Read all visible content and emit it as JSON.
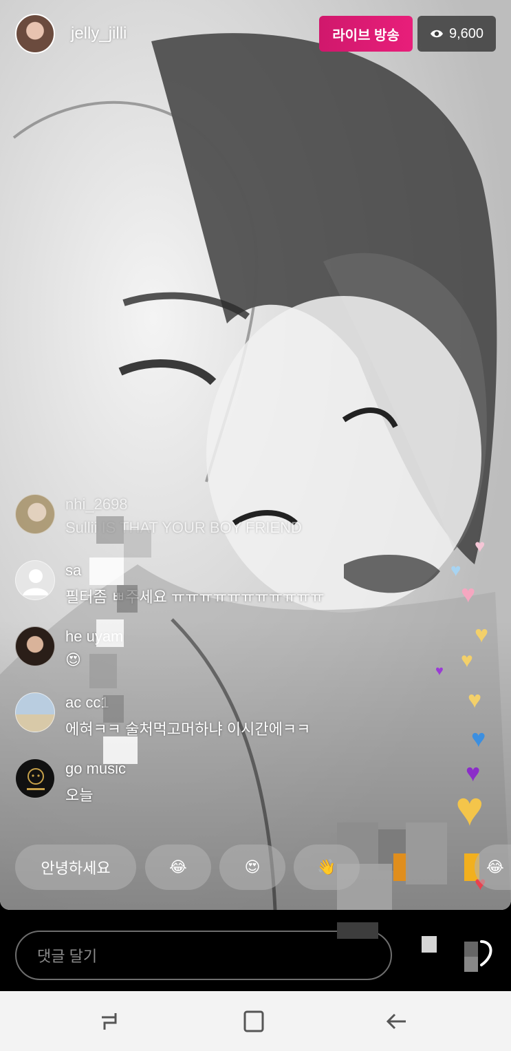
{
  "header": {
    "username": "jelly_jilli",
    "live_label": "라이브 방송",
    "viewer_count": "9,600",
    "viewer_icon": "eye-icon"
  },
  "comments": [
    {
      "name": "nhi_2698",
      "text": "Sullii IS THAT YOUR BOY FRIEND",
      "faded": true
    },
    {
      "name": "sa",
      "text": "필터좀 ㅃ주세요 ㅠㅠㅠㅠㅠㅠㅠㅠㅠㅠㅠ"
    },
    {
      "name": "he      uyam",
      "text": "😍"
    },
    {
      "name": "ac      cc1",
      "text": "에혀ㅋㅋ 술처먹고머하냐 이시간에ㅋㅋ"
    },
    {
      "name": "go      music",
      "text": "오늘"
    }
  ],
  "quick_replies": [
    "안녕하세요",
    "😂",
    "😍",
    "👋",
    "😂"
  ],
  "input": {
    "placeholder": "댓글 달기"
  },
  "nav": {
    "recent": "recent-apps-icon",
    "home": "home-icon",
    "back": "back-icon"
  },
  "colors": {
    "live": "#e81e7a",
    "viewer_bg": "#3c3c3c"
  }
}
